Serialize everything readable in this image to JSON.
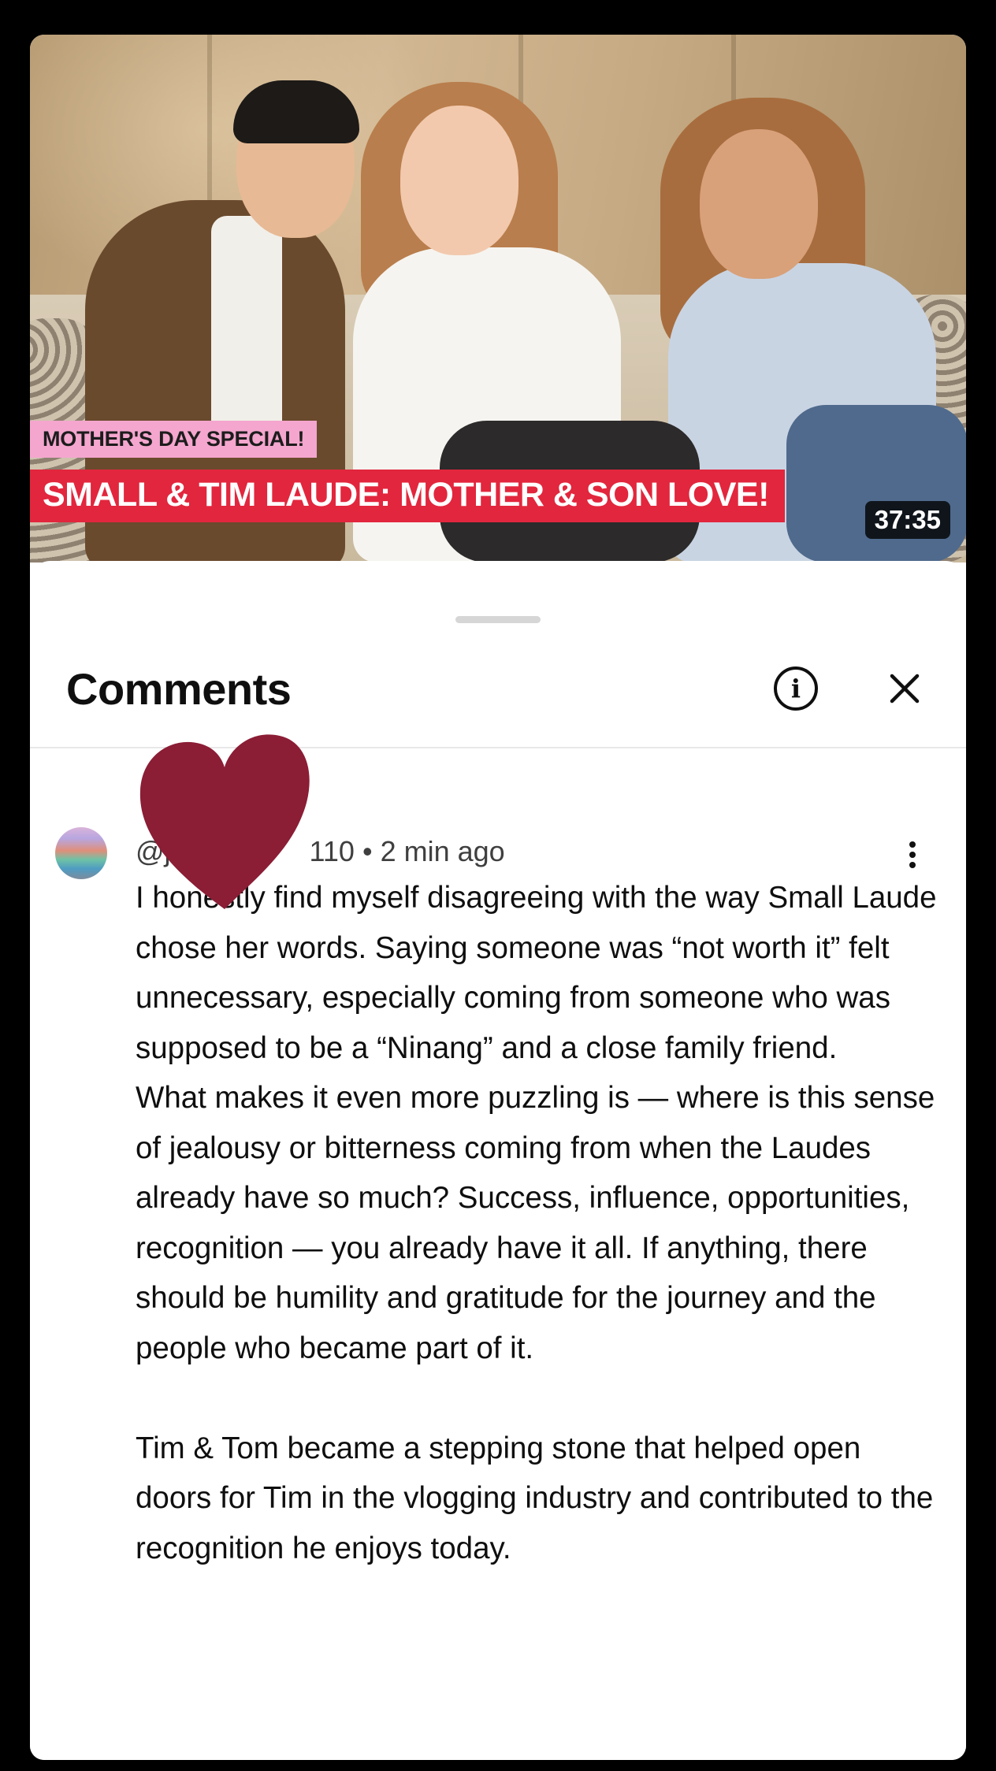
{
  "video": {
    "tag_label": "MOTHER'S DAY SPECIAL!",
    "title_banner": "SMALL & TIM LAUDE: MOTHER & SON LOVE!",
    "duration": "37:35"
  },
  "comments_panel": {
    "title": "Comments",
    "info_icon": "info-icon",
    "close_icon": "close-icon",
    "overlay_sticker": "heart-sticker"
  },
  "comment": {
    "handle": "@j",
    "handle_tail": "110",
    "separator": "•",
    "time": "2 min ago",
    "menu_icon": "vertical-dots-icon",
    "text": "I honestly find myself disagreeing with the way Small Laude chose her words. Saying someone was “not worth it” felt unnecessary, especially coming from someone who was supposed to be a “Ninang” and a close family friend.\nWhat makes it even more puzzling is — where is this sense of jealousy or bitterness coming from when the Laudes already have so much? Success, influence, opportunities, recognition — you already have it all. If anything, there should be humility and gratitude for the journey and the people who became part of it.\n\nTim & Tom became a stepping stone that helped open doors for Tim in the vlogging industry and contributed to the recognition he enjoys today."
  },
  "colors": {
    "title_banner_bg": "#e2263d",
    "tag_bg": "#f4a6ce",
    "heart": "#8b1d35"
  }
}
